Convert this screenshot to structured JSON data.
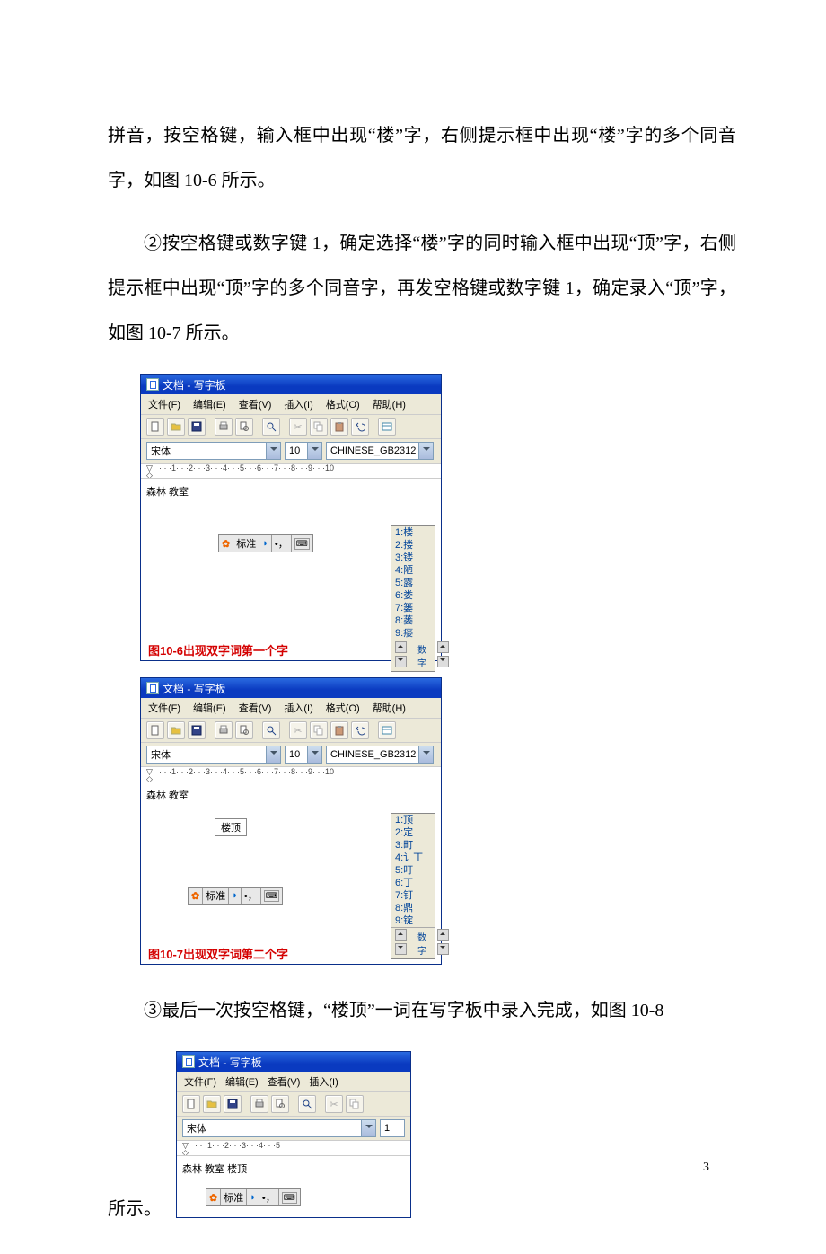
{
  "para1": "拼音，按空格键，输入框中出现“楼”字，右侧提示框中出现“楼”字的多个同音字，如图 10-6 所示。",
  "para2": "②按空格键或数字键 1，确定选择“楼”字的同时输入框中出现“顶”字，右侧提示框中出现“顶”字的多个同音字，再发空格键或数字键 1，确定录入“顶”字，如图 10-7 所示。",
  "para3": "③最后一次按空格键，“楼顶”一词在写字板中录入完成，如图 10-8",
  "para4": "所示。",
  "pagenum": "3",
  "fig1": {
    "title": "文档 - 写字板",
    "menus": [
      "文件(F)",
      "编辑(E)",
      "查看(V)",
      "插入(I)",
      "格式(O)",
      "帮助(H)"
    ],
    "font": "宋体",
    "fontsize": "10",
    "charset": "CHINESE_GB2312",
    "body_text": "森林 教室",
    "ime_label": "标准",
    "candidates": [
      "1:楼",
      "2:搂",
      "3:镂",
      "4:陋",
      "5:露",
      "6:娄",
      "7:篓",
      "8:蒌",
      "9:瘘"
    ],
    "cand_foot": "数字",
    "caption": "图10-6出现双字词第一个字"
  },
  "fig2": {
    "title": "文档 - 写字板",
    "menus": [
      "文件(F)",
      "编辑(E)",
      "查看(V)",
      "插入(I)",
      "格式(O)",
      "帮助(H)"
    ],
    "font": "宋体",
    "fontsize": "10",
    "charset": "CHINESE_GB2312",
    "body_text": "森林 教室",
    "input_text": "楼顶",
    "ime_label": "标准",
    "candidates": [
      "1:顶",
      "2:定",
      "3:町",
      "4:讠丁",
      "5:叮",
      "6:丁",
      "7:钉",
      "8:鼎",
      "9:锭"
    ],
    "cand_foot": "数字",
    "caption": "图10-7出现双字词第二个字"
  },
  "fig3": {
    "title": "文档 - 写字板",
    "menus": [
      "文件(F)",
      "编辑(E)",
      "查看(V)",
      "插入(I)"
    ],
    "font": "宋体",
    "fontsize": "1",
    "body_text": "森林 教室   楼顶",
    "ime_label": "标准"
  }
}
